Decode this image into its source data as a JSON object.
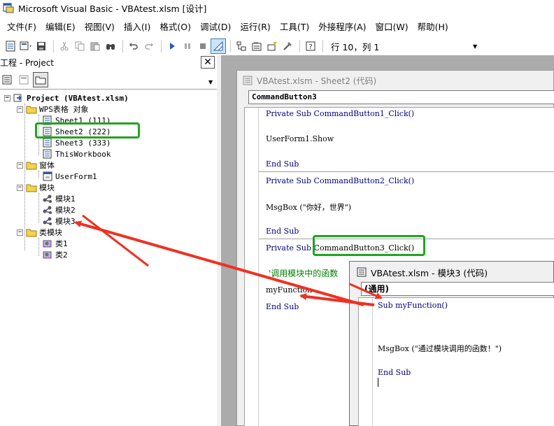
{
  "window": {
    "title": "Microsoft Visual Basic - VBAtest.xlsm [设计]"
  },
  "menu": [
    "文件(F)",
    "编辑(E)",
    "视图(V)",
    "插入(I)",
    "格式(O)",
    "调试(D)",
    "运行(R)",
    "工具(T)",
    "外接程序(A)",
    "窗口(W)",
    "帮助(H)"
  ],
  "toolbar": {
    "cursor_position": "行 10，列 1",
    "icons": [
      "view-excel-icon",
      "insert-userform-icon",
      "save-icon",
      "cut-icon",
      "copy-icon",
      "paste-icon",
      "find-icon",
      "undo-icon",
      "redo-icon",
      "run-icon",
      "break-icon",
      "reset-icon",
      "design-mode-icon",
      "project-explorer-icon",
      "properties-icon",
      "object-browser-icon",
      "toolbox-icon",
      "help-icon"
    ]
  },
  "project_panel": {
    "title": "工程 - Project",
    "close_glyph": "✕",
    "root": "Project (VBAtest.xlsm)",
    "groups": [
      {
        "label": "WPS表格 对象",
        "items": [
          "Sheet1 (111)",
          "Sheet2 (222)",
          "Sheet3 (333)",
          "ThisWorkbook"
        ]
      },
      {
        "label": "窗体",
        "items": [
          "UserForm1"
        ]
      },
      {
        "label": "模块",
        "items": [
          "模块1",
          "模块2",
          "模块3"
        ]
      },
      {
        "label": "类模块",
        "items": [
          "类1",
          "类2"
        ]
      }
    ]
  },
  "code_window_sheet2": {
    "title": "VBAtest.xlsm - Sheet2 (代码)",
    "object": "CommandButton3",
    "lines": {
      "l1": "Private Sub CommandButton1_Click()",
      "l2": "UserForm1.Show",
      "l3": "End Sub",
      "l4": "Private Sub CommandButton2_Click()",
      "l5": "MsgBox (\"你好，世界\")",
      "l6": "End Sub",
      "l7a": "Private Sub ",
      "l7b": "CommandButton3_Click()",
      "l8": "'调用模块中的函数",
      "l9": "myFunction",
      "l10": "End Sub"
    }
  },
  "code_window_module3": {
    "title": "VBAtest.xlsm - 模块3 (代码)",
    "object": "(通用)",
    "lines": {
      "l1": "Sub myFunction()",
      "l2": "MsgBox (\"通过模块调用的函数！\")",
      "l3": "End Sub"
    }
  },
  "colors": {
    "annotation_box": "#1fa51f",
    "annotation_arrow": "#f03020",
    "keyword": "#00007f",
    "comment": "#007f00"
  }
}
